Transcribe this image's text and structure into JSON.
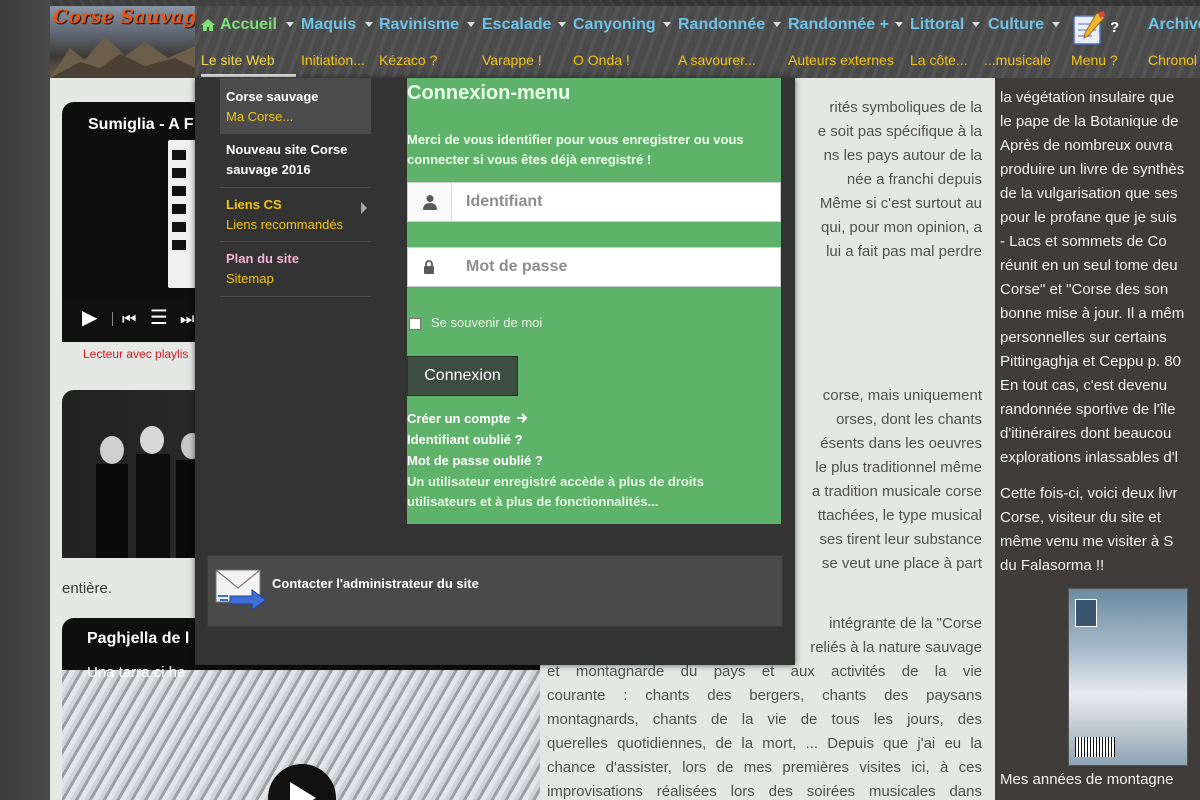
{
  "site": {
    "logo_text": "Corse Sauvage"
  },
  "nav": [
    {
      "label": "Accueil",
      "sub": "Le site Web"
    },
    {
      "label": "Maquis",
      "sub": "Initiation..."
    },
    {
      "label": "Ravinisme",
      "sub": "Kézaco ?"
    },
    {
      "label": "Escalade",
      "sub": "Varappe !"
    },
    {
      "label": "Canyoning",
      "sub": "O Onda !"
    },
    {
      "label": "Randonnée",
      "sub": "A savourer..."
    },
    {
      "label": "Randonnée +",
      "sub": "Auteurs externes"
    },
    {
      "label": "Littoral",
      "sub": "La côte..."
    },
    {
      "label": "Culture",
      "sub": "...musicale"
    },
    {
      "label": "?",
      "sub": "Menu ?"
    },
    {
      "label": "Archive",
      "sub": "Chronol"
    }
  ],
  "side_menu": [
    {
      "title": "Corse sauvage",
      "sub": "Ma Corse..."
    },
    {
      "title": "Nouveau site Corse sauvage 2016",
      "sub": ""
    },
    {
      "title": "Liens CS",
      "sub": "Liens recommandés"
    },
    {
      "title": "Plan du site",
      "sub": "Sitemap"
    }
  ],
  "login": {
    "title": "Connexion-menu",
    "message": "Merci de vous identifier pour vous enregistrer ou vous connecter si vous êtes déjà enregistré !",
    "username_placeholder": "Identifiant",
    "password_placeholder": "Mot de passe",
    "remember": "Se souvenir de moi",
    "button": "Connexion",
    "create_account": "Créer un compte",
    "forgot_user": "Identifiant oublié ?",
    "forgot_password": "Mot de passe oublié ?",
    "note_1": "Un utilisateur enregistré accède à plus de droits",
    "note_2": "utilisateurs et à plus de fonctionnalités..."
  },
  "contact": {
    "label": "Contacter l'administrateur du site"
  },
  "left": {
    "video1_title": "Sumiglia - A F",
    "player_caption": "Lecteur avec playlis",
    "entiere": "entière.",
    "video3_title": "Paghjella de l",
    "video3_sub": "Una tarra ci he"
  },
  "mid_lines_top": [
    "rités symboliques de la",
    "e soit pas spécifique à la",
    "ns les pays autour de la",
    "née a franchi depuis",
    "Même si c'est surtout au",
    "qui, pour mon opinion, a",
    "lui a fait pas mal perdre"
  ],
  "mid_lines_mid": [
    "corse, mais uniquement",
    "orses, dont les chants",
    "ésents dans les oeuvres",
    "le plus traditionnel même",
    "a tradition musicale corse",
    "ttachées, le type musical",
    "ses tirent leur substance",
    "se veut une place à part"
  ],
  "mid_lines_bottom": [
    "intégrante de la \"Corse",
    "reliés à la nature sauvage"
  ],
  "mid_full_lines": [
    "et montagnarde du pays et aux activités de la vie",
    "courante : chants des bergers, chants des paysans",
    "montagnards, chants de la vie de tous les jours, des",
    "querelles quotidiennes, de la mort, ... Depuis que j'ai eu la",
    "chance d'assister, lors de mes premières visites ici, à ces",
    "improvisations réalisées lors des soirées musicales dans"
  ],
  "right_lines_1": [
    "la végétation insulaire que",
    "le pape de la Botanique de",
    "Après de nombreux ouvra",
    "produire un livre de synthès",
    "de la vulgarisation que ses",
    "pour le profane que je suis",
    "- Lacs et sommets de Co",
    "réunit en un seul tome deu",
    "Corse\" et \"Corse des son",
    "bonne mise à jour. Il a mêm",
    "personnelles sur certains",
    "Pittingaghja et Ceppu p. 80",
    "En tout cas, c'est devenu",
    "randonnée sportive de l'île",
    "d'itinéraires dont beaucou",
    "explorations inlassables d'l"
  ],
  "right_lines_2": [
    "Cette fois-ci, voici deux livr",
    "Corse, visiteur du site et",
    "même venu me visiter à S",
    "du Falasorma !!"
  ],
  "right_bottom": "Mes années de montagne",
  "colors": {
    "login_green": "#5fb26a",
    "nav_blue": "#6fc2e8",
    "nav_yellow": "#f2c318",
    "active_green": "#7fe07a"
  }
}
